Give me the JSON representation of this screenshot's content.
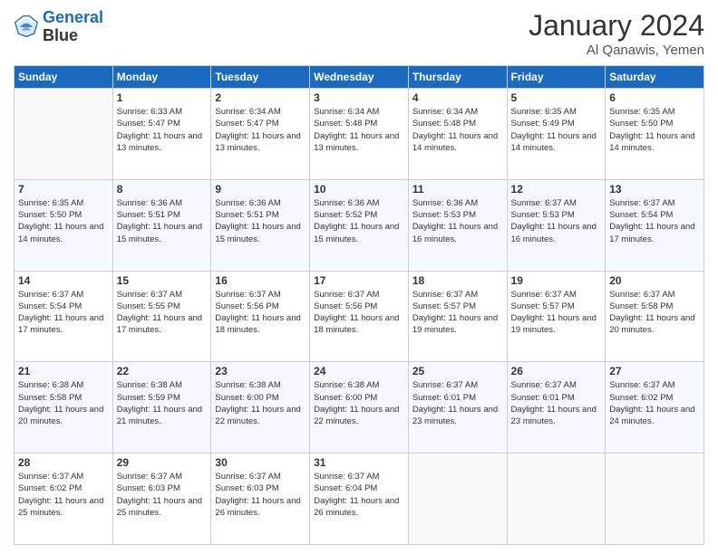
{
  "header": {
    "logo_line1": "General",
    "logo_line2": "Blue",
    "month": "January 2024",
    "location": "Al Qanawis, Yemen"
  },
  "weekdays": [
    "Sunday",
    "Monday",
    "Tuesday",
    "Wednesday",
    "Thursday",
    "Friday",
    "Saturday"
  ],
  "weeks": [
    [
      {
        "day": "",
        "sunrise": "",
        "sunset": "",
        "daylight": ""
      },
      {
        "day": "1",
        "sunrise": "Sunrise: 6:33 AM",
        "sunset": "Sunset: 5:47 PM",
        "daylight": "Daylight: 11 hours and 13 minutes."
      },
      {
        "day": "2",
        "sunrise": "Sunrise: 6:34 AM",
        "sunset": "Sunset: 5:47 PM",
        "daylight": "Daylight: 11 hours and 13 minutes."
      },
      {
        "day": "3",
        "sunrise": "Sunrise: 6:34 AM",
        "sunset": "Sunset: 5:48 PM",
        "daylight": "Daylight: 11 hours and 13 minutes."
      },
      {
        "day": "4",
        "sunrise": "Sunrise: 6:34 AM",
        "sunset": "Sunset: 5:48 PM",
        "daylight": "Daylight: 11 hours and 14 minutes."
      },
      {
        "day": "5",
        "sunrise": "Sunrise: 6:35 AM",
        "sunset": "Sunset: 5:49 PM",
        "daylight": "Daylight: 11 hours and 14 minutes."
      },
      {
        "day": "6",
        "sunrise": "Sunrise: 6:35 AM",
        "sunset": "Sunset: 5:50 PM",
        "daylight": "Daylight: 11 hours and 14 minutes."
      }
    ],
    [
      {
        "day": "7",
        "sunrise": "Sunrise: 6:35 AM",
        "sunset": "Sunset: 5:50 PM",
        "daylight": "Daylight: 11 hours and 14 minutes."
      },
      {
        "day": "8",
        "sunrise": "Sunrise: 6:36 AM",
        "sunset": "Sunset: 5:51 PM",
        "daylight": "Daylight: 11 hours and 15 minutes."
      },
      {
        "day": "9",
        "sunrise": "Sunrise: 6:36 AM",
        "sunset": "Sunset: 5:51 PM",
        "daylight": "Daylight: 11 hours and 15 minutes."
      },
      {
        "day": "10",
        "sunrise": "Sunrise: 6:36 AM",
        "sunset": "Sunset: 5:52 PM",
        "daylight": "Daylight: 11 hours and 15 minutes."
      },
      {
        "day": "11",
        "sunrise": "Sunrise: 6:36 AM",
        "sunset": "Sunset: 5:53 PM",
        "daylight": "Daylight: 11 hours and 16 minutes."
      },
      {
        "day": "12",
        "sunrise": "Sunrise: 6:37 AM",
        "sunset": "Sunset: 5:53 PM",
        "daylight": "Daylight: 11 hours and 16 minutes."
      },
      {
        "day": "13",
        "sunrise": "Sunrise: 6:37 AM",
        "sunset": "Sunset: 5:54 PM",
        "daylight": "Daylight: 11 hours and 17 minutes."
      }
    ],
    [
      {
        "day": "14",
        "sunrise": "Sunrise: 6:37 AM",
        "sunset": "Sunset: 5:54 PM",
        "daylight": "Daylight: 11 hours and 17 minutes."
      },
      {
        "day": "15",
        "sunrise": "Sunrise: 6:37 AM",
        "sunset": "Sunset: 5:55 PM",
        "daylight": "Daylight: 11 hours and 17 minutes."
      },
      {
        "day": "16",
        "sunrise": "Sunrise: 6:37 AM",
        "sunset": "Sunset: 5:56 PM",
        "daylight": "Daylight: 11 hours and 18 minutes."
      },
      {
        "day": "17",
        "sunrise": "Sunrise: 6:37 AM",
        "sunset": "Sunset: 5:56 PM",
        "daylight": "Daylight: 11 hours and 18 minutes."
      },
      {
        "day": "18",
        "sunrise": "Sunrise: 6:37 AM",
        "sunset": "Sunset: 5:57 PM",
        "daylight": "Daylight: 11 hours and 19 minutes."
      },
      {
        "day": "19",
        "sunrise": "Sunrise: 6:37 AM",
        "sunset": "Sunset: 5:57 PM",
        "daylight": "Daylight: 11 hours and 19 minutes."
      },
      {
        "day": "20",
        "sunrise": "Sunrise: 6:37 AM",
        "sunset": "Sunset: 5:58 PM",
        "daylight": "Daylight: 11 hours and 20 minutes."
      }
    ],
    [
      {
        "day": "21",
        "sunrise": "Sunrise: 6:38 AM",
        "sunset": "Sunset: 5:58 PM",
        "daylight": "Daylight: 11 hours and 20 minutes."
      },
      {
        "day": "22",
        "sunrise": "Sunrise: 6:38 AM",
        "sunset": "Sunset: 5:59 PM",
        "daylight": "Daylight: 11 hours and 21 minutes."
      },
      {
        "day": "23",
        "sunrise": "Sunrise: 6:38 AM",
        "sunset": "Sunset: 6:00 PM",
        "daylight": "Daylight: 11 hours and 22 minutes."
      },
      {
        "day": "24",
        "sunrise": "Sunrise: 6:38 AM",
        "sunset": "Sunset: 6:00 PM",
        "daylight": "Daylight: 11 hours and 22 minutes."
      },
      {
        "day": "25",
        "sunrise": "Sunrise: 6:37 AM",
        "sunset": "Sunset: 6:01 PM",
        "daylight": "Daylight: 11 hours and 23 minutes."
      },
      {
        "day": "26",
        "sunrise": "Sunrise: 6:37 AM",
        "sunset": "Sunset: 6:01 PM",
        "daylight": "Daylight: 11 hours and 23 minutes."
      },
      {
        "day": "27",
        "sunrise": "Sunrise: 6:37 AM",
        "sunset": "Sunset: 6:02 PM",
        "daylight": "Daylight: 11 hours and 24 minutes."
      }
    ],
    [
      {
        "day": "28",
        "sunrise": "Sunrise: 6:37 AM",
        "sunset": "Sunset: 6:02 PM",
        "daylight": "Daylight: 11 hours and 25 minutes."
      },
      {
        "day": "29",
        "sunrise": "Sunrise: 6:37 AM",
        "sunset": "Sunset: 6:03 PM",
        "daylight": "Daylight: 11 hours and 25 minutes."
      },
      {
        "day": "30",
        "sunrise": "Sunrise: 6:37 AM",
        "sunset": "Sunset: 6:03 PM",
        "daylight": "Daylight: 11 hours and 26 minutes."
      },
      {
        "day": "31",
        "sunrise": "Sunrise: 6:37 AM",
        "sunset": "Sunset: 6:04 PM",
        "daylight": "Daylight: 11 hours and 26 minutes."
      },
      {
        "day": "",
        "sunrise": "",
        "sunset": "",
        "daylight": ""
      },
      {
        "day": "",
        "sunrise": "",
        "sunset": "",
        "daylight": ""
      },
      {
        "day": "",
        "sunrise": "",
        "sunset": "",
        "daylight": ""
      }
    ]
  ]
}
